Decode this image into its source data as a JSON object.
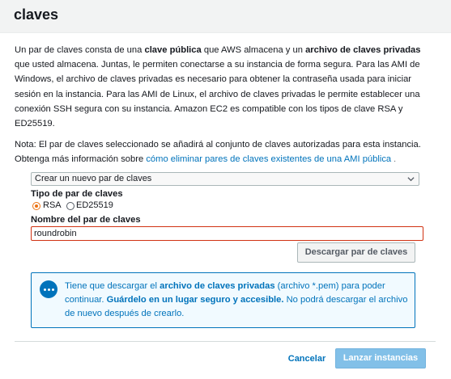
{
  "dialog": {
    "title": "claves"
  },
  "intro": {
    "t1": "Un par de claves consta de una ",
    "b1": "clave pública",
    "t2": " que AWS almacena y un ",
    "b2": "archivo de claves privadas",
    "t3": " que usted almacena. Juntas, le permiten conectarse a su instancia de forma segura. Para las AMI de Windows, el archivo de claves privadas es necesario para obtener la contraseña usada para iniciar sesión en la instancia. Para las AMI de Linux, el archivo de claves privadas le permite establecer una conexión SSH segura con su instancia. Amazon EC2 es compatible con los tipos de clave RSA y ED25519."
  },
  "note": {
    "text": "Nota: El par de claves seleccionado se añadirá al conjunto de claves autorizadas para esta instancia. Obtenga más información sobre ",
    "link": "cómo eliminar pares de claves existentes de una AMI pública",
    "arrow": "."
  },
  "key_pair_select": {
    "value": "Crear un nuevo par de claves"
  },
  "key_type": {
    "label": "Tipo de par de claves",
    "options": [
      "RSA",
      "ED25519"
    ],
    "selected": "RSA"
  },
  "key_name": {
    "label": "Nombre del par de claves",
    "value": "roundrobin"
  },
  "download_button": {
    "label": "Descargar par de claves"
  },
  "alert": {
    "t1": "Tiene que descargar el ",
    "b1": "archivo de claves privadas",
    "t2": " (archivo *.pem) para poder continuar. ",
    "b2": "Guárdelo en un lugar seguro y accesible.",
    "t3": " No podrá descargar el archivo de nuevo después de crearlo."
  },
  "footer": {
    "cancel_label": "Cancelar",
    "launch_label": "Lanzar instancias"
  },
  "colors": {
    "accent_link": "#0073bb",
    "radio_selected": "#ec7211",
    "input_error_border": "#d13212",
    "alert_background": "#f1faff",
    "launch_button_disabled": "#82c0e8"
  },
  "icons": {
    "alert": "info-speech-bubble-icon",
    "select": "chevron-down-icon"
  }
}
